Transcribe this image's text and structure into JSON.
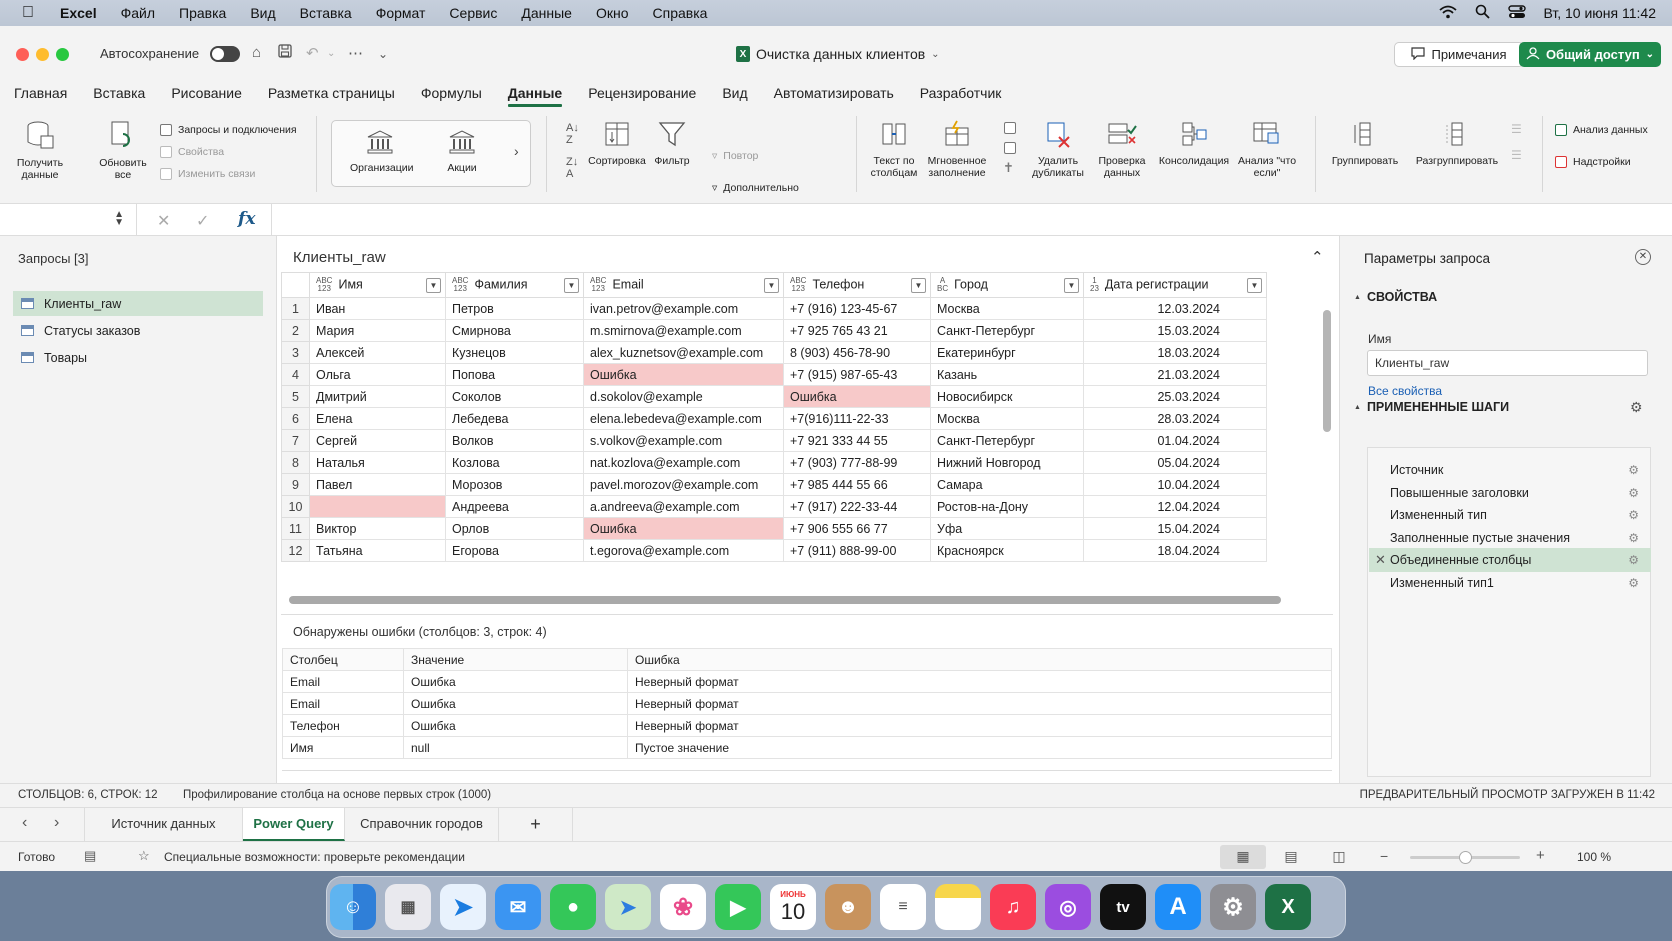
{
  "menubar": {
    "apple": "",
    "app": "Excel",
    "items": [
      "Файл",
      "Правка",
      "Вид",
      "Вставка",
      "Формат",
      "Сервис",
      "Данные",
      "Окно",
      "Справка"
    ],
    "datetime": "Вт, 10 июня  11:42"
  },
  "titlebar": {
    "autosave_label": "Автосохранение",
    "doc_title": "Очистка данных клиентов",
    "notes_label": "Примечания",
    "share_label": "Общий доступ"
  },
  "ribbon_tabs": [
    "Главная",
    "Вставка",
    "Рисование",
    "Разметка страницы",
    "Формулы",
    "Данные",
    "Рецензирование",
    "Вид",
    "Автоматизировать",
    "Разработчик"
  ],
  "ribbon": {
    "get_data": "Получить данные",
    "refresh_all": "Обновить все",
    "queries_connections": "Запросы и подключения",
    "properties": "Свойства",
    "edit_links": "Изменить связи",
    "organizations": "Организации",
    "stocks": "Акции",
    "sort": "Сортировка",
    "filter": "Фильтр",
    "reapply": "Повтор",
    "advanced": "Дополнительно",
    "text_to_columns": "Текст по столбцам",
    "flash_fill": "Мгновенное заполнение",
    "remove_duplicates": "Удалить дубликаты",
    "data_validation": "Проверка данных",
    "consolidate": "Консолидация",
    "what_if": "Анализ \"что если\"",
    "group": "Группировать",
    "ungroup": "Разгруппировать",
    "analyze_data": "Анализ данных",
    "addins": "Надстройки"
  },
  "formula": {
    "fx": "fx"
  },
  "queries": {
    "title": "Запросы [3]",
    "items": [
      "Клиенты_raw",
      "Статусы заказов",
      "Товары"
    ]
  },
  "preview": {
    "title": "Клиенты_raw",
    "columns": [
      {
        "type_top": "ABC",
        "type_bottom": "123",
        "name": "Имя"
      },
      {
        "type_top": "ABC",
        "type_bottom": "123",
        "name": "Фамилия"
      },
      {
        "type_top": "ABC",
        "type_bottom": "123",
        "name": "Email"
      },
      {
        "type_top": "ABC",
        "type_bottom": "123",
        "name": "Телефон"
      },
      {
        "type_top": "A",
        "type_bottom": "BC",
        "name": "Город"
      },
      {
        "type_top": "1",
        "type_bottom": "23",
        "name": "Дата регистрации"
      }
    ],
    "rows": [
      [
        "1",
        "Иван",
        "Петров",
        "ivan.petrov@example.com",
        "+7 (916) 123-45-67",
        "Москва",
        "12.03.2024"
      ],
      [
        "2",
        "Мария",
        "Смирнова",
        "m.smirnova@example.com",
        "+7 925 765 43 21",
        "Санкт-Петербург",
        "15.03.2024"
      ],
      [
        "3",
        "Алексей",
        "Кузнецов",
        "alex_kuznetsov@example.com",
        "8 (903) 456-78-90",
        "Екатеринбург",
        "18.03.2024"
      ],
      [
        "4",
        "Ольга",
        "Попова",
        "Ошибка",
        "+7 (915) 987-65-43",
        "Казань",
        "21.03.2024"
      ],
      [
        "5",
        "Дмитрий",
        "Соколов",
        "d.sokolov@example",
        "Ошибка",
        "Новосибирск",
        "25.03.2024"
      ],
      [
        "6",
        "Елена",
        "Лебедева",
        "elena.lebedeva@example.com",
        "+7(916)111-22-33",
        "Москва",
        "28.03.2024"
      ],
      [
        "7",
        "Сергей",
        "Волков",
        "s.volkov@example.com",
        "+7 921 333 44 55",
        "Санкт-Петербург",
        "01.04.2024"
      ],
      [
        "8",
        "Наталья",
        "Козлова",
        "nat.kozlova@example.com",
        "+7 (903) 777-88-99",
        "Нижний Новгород",
        "05.04.2024"
      ],
      [
        "9",
        "Павел",
        "Морозов",
        "pavel.morozov@example.com",
        "+7 985 444 55 66",
        "Самара",
        "10.04.2024"
      ],
      [
        "10",
        "",
        "Андреева",
        "a.andreeva@example.com",
        "+7 (917) 222-33-44",
        "Ростов-на-Дону",
        "12.04.2024"
      ],
      [
        "11",
        "Виктор",
        "Орлов",
        "Ошибка",
        "+7 906 555 66 77",
        "Уфа",
        "15.04.2024"
      ],
      [
        "12",
        "Татьяна",
        "Егорова",
        "t.egorova@example.com",
        "+7 (911) 888-99-00",
        "Красноярск",
        "18.04.2024"
      ]
    ],
    "error_cells": [
      [
        4,
        3
      ],
      [
        5,
        4
      ],
      [
        10,
        1
      ],
      [
        11,
        3
      ]
    ]
  },
  "errors": {
    "title": "Обнаружены ошибки (столбцов: 3, строк: 4)",
    "headers": [
      "Столбец",
      "Значение",
      "Ошибка"
    ],
    "rows": [
      [
        "Email",
        "Ошибка",
        "Неверный формат"
      ],
      [
        "Email",
        "Ошибка",
        "Неверный формат"
      ],
      [
        "Телефон",
        "Ошибка",
        "Неверный формат"
      ],
      [
        "Имя",
        "null",
        "Пустое значение"
      ]
    ]
  },
  "query_settings": {
    "title": "Параметры запроса",
    "properties_label": "СВОЙСТВА",
    "name_label": "Имя",
    "name_value": "Клиенты_raw",
    "all_properties": "Все свойства",
    "steps_label": "ПРИМЕНЕННЫЕ ШАГИ",
    "steps": [
      "Источник",
      "Повышенные заголовки",
      "Измененный тип",
      "Заполненные пустые значения",
      "Объединенные столбцы",
      "Измененный тип1"
    ],
    "selected_step": 4
  },
  "status": {
    "counts": "СТОЛБЦОВ: 6, СТРОК: 12",
    "profiling": "Профилирование столбца на основе первых строк (1000)",
    "preview_loaded": "ПРЕДВАРИТЕЛЬНЫЙ ПРОСМОТР ЗАГРУЖЕН В 11:42"
  },
  "sheets": {
    "tabs": [
      "Источник данных",
      "Power Query",
      "Справочник городов"
    ],
    "active": 1,
    "add": "+"
  },
  "bottom": {
    "ready": "Готово",
    "accessibility": "Специальные возможности: проверьте рекомендации",
    "zoom": "100 %",
    "zoom_level": 0.5
  },
  "dock": {
    "calendar_month": "ИЮНЬ",
    "calendar_day": "10",
    "tv_label": "tv"
  },
  "colors": {
    "accent": "#1e7145",
    "error_fill": "#f7c9c9",
    "selected": "#cfe3d3",
    "link": "#1a5fb4"
  }
}
